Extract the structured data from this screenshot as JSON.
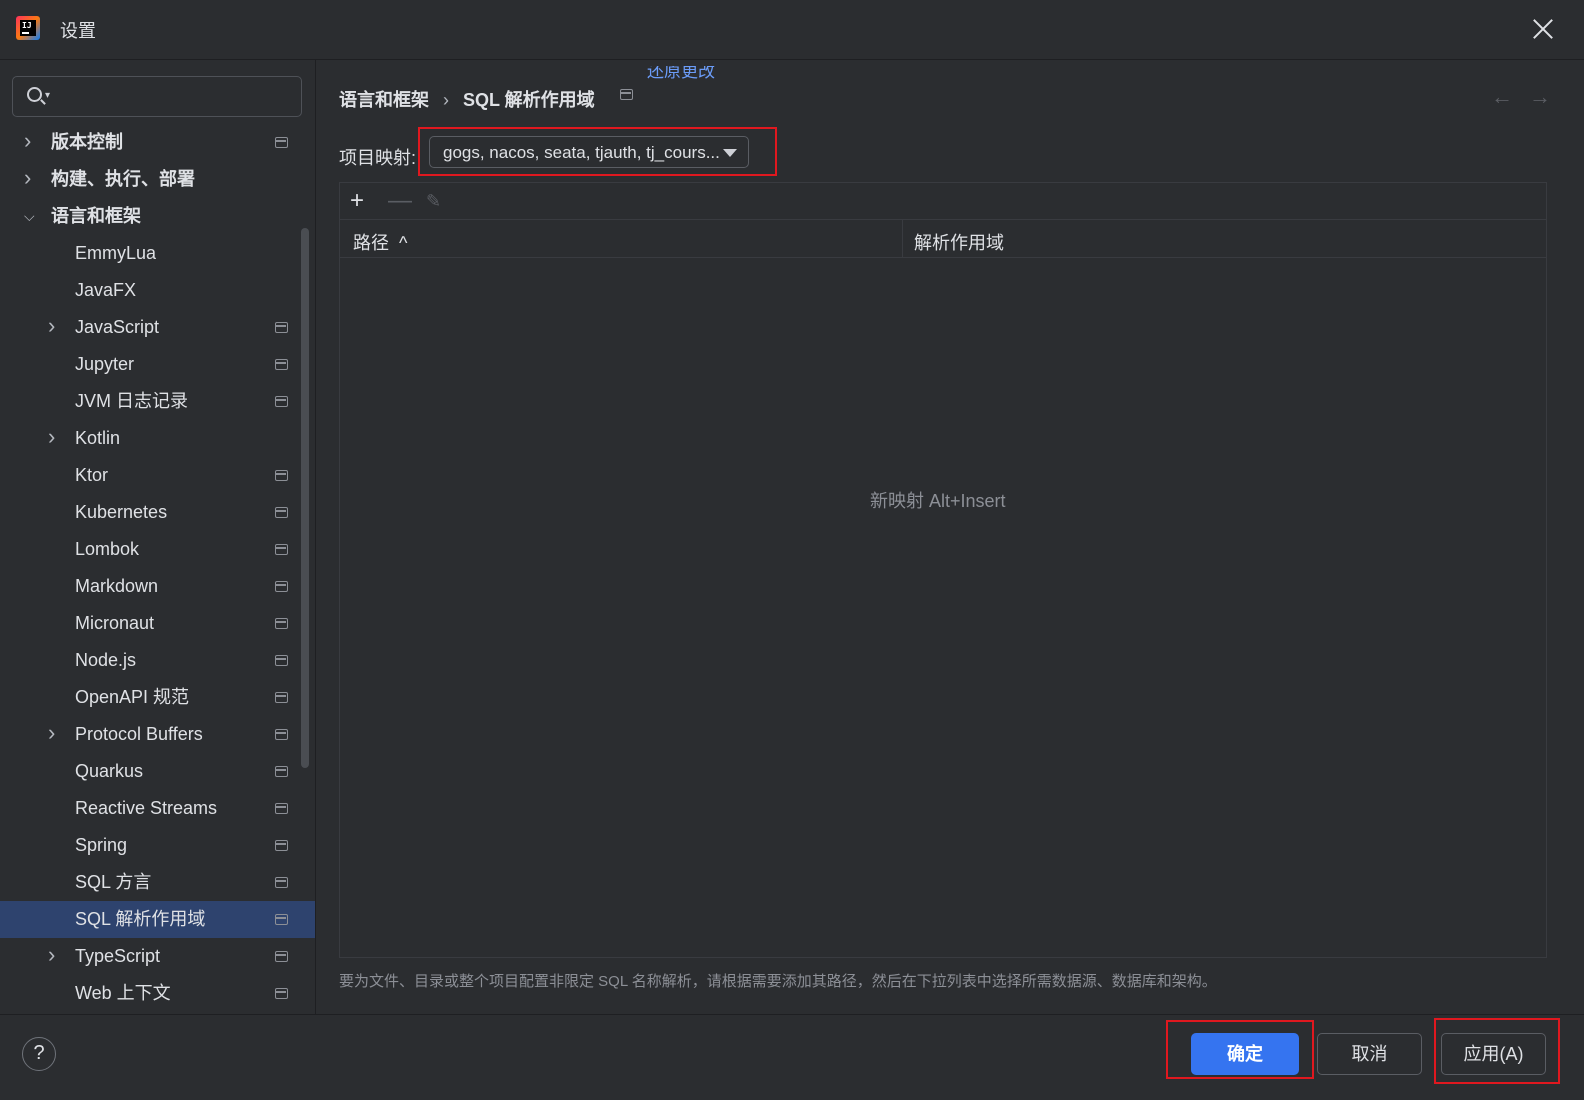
{
  "window": {
    "title": "设置",
    "close_icon": "close-icon"
  },
  "search": {
    "placeholder": "",
    "value": ""
  },
  "sidebar": {
    "items": [
      {
        "label": "版本控制",
        "level": 0,
        "expandable": true,
        "expanded": false,
        "bold": true,
        "scope": true
      },
      {
        "label": "构建、执行、部署",
        "level": 0,
        "expandable": true,
        "expanded": false,
        "bold": true,
        "scope": false
      },
      {
        "label": "语言和框架",
        "level": 0,
        "expandable": true,
        "expanded": true,
        "bold": true,
        "scope": false
      },
      {
        "label": "EmmyLua",
        "level": 1,
        "expandable": false,
        "scope": false
      },
      {
        "label": "JavaFX",
        "level": 1,
        "expandable": false,
        "scope": false
      },
      {
        "label": "JavaScript",
        "level": 1,
        "expandable": true,
        "scope": true
      },
      {
        "label": "Jupyter",
        "level": 1,
        "expandable": false,
        "scope": true
      },
      {
        "label": "JVM 日志记录",
        "level": 1,
        "expandable": false,
        "scope": true
      },
      {
        "label": "Kotlin",
        "level": 1,
        "expandable": true,
        "scope": false
      },
      {
        "label": "Ktor",
        "level": 1,
        "expandable": false,
        "scope": true
      },
      {
        "label": "Kubernetes",
        "level": 1,
        "expandable": false,
        "scope": true
      },
      {
        "label": "Lombok",
        "level": 1,
        "expandable": false,
        "scope": true
      },
      {
        "label": "Markdown",
        "level": 1,
        "expandable": false,
        "scope": true
      },
      {
        "label": "Micronaut",
        "level": 1,
        "expandable": false,
        "scope": true
      },
      {
        "label": "Node.js",
        "level": 1,
        "expandable": false,
        "scope": true
      },
      {
        "label": "OpenAPI 规范",
        "level": 1,
        "expandable": false,
        "scope": true
      },
      {
        "label": "Protocol Buffers",
        "level": 1,
        "expandable": true,
        "scope": true
      },
      {
        "label": "Quarkus",
        "level": 1,
        "expandable": false,
        "scope": true
      },
      {
        "label": "Reactive Streams",
        "level": 1,
        "expandable": false,
        "scope": true
      },
      {
        "label": "Spring",
        "level": 1,
        "expandable": false,
        "scope": true
      },
      {
        "label": "SQL 方言",
        "level": 1,
        "expandable": false,
        "scope": true
      },
      {
        "label": "SQL 解析作用域",
        "level": 1,
        "expandable": false,
        "scope": true,
        "selected": true
      },
      {
        "label": "TypeScript",
        "level": 1,
        "expandable": true,
        "scope": true
      },
      {
        "label": "Web 上下文",
        "level": 1,
        "expandable": false,
        "scope": true
      }
    ]
  },
  "main": {
    "breadcrumb": {
      "parent": "语言和框架",
      "separator": "›",
      "current": "SQL 解析作用域"
    },
    "reset_link": "还原更改",
    "nav": {
      "back": "←",
      "forward": "→"
    },
    "mapping": {
      "label": "项目映射:",
      "value": "gogs, nacos, seata, tjauth, tj_cours..."
    },
    "toolbar": {
      "add": "+",
      "remove": "—",
      "edit": "✎"
    },
    "table": {
      "columns": [
        {
          "label": "路径",
          "sort": "^"
        },
        {
          "label": "解析作用域"
        }
      ],
      "rows": [],
      "empty_hint": "新映射 Alt+Insert"
    },
    "help_text": "要为文件、目录或整个项目配置非限定 SQL 名称解析，请根据需要添加其路径，然后在下拉列表中选择所需数据源、数据库和架构。"
  },
  "footer": {
    "help": "?",
    "ok": "确定",
    "cancel": "取消",
    "apply": "应用(A)"
  },
  "colors": {
    "accent": "#3574f0",
    "selection": "#2e436e",
    "highlight": "#e0181f",
    "link": "#6b9cf8"
  }
}
